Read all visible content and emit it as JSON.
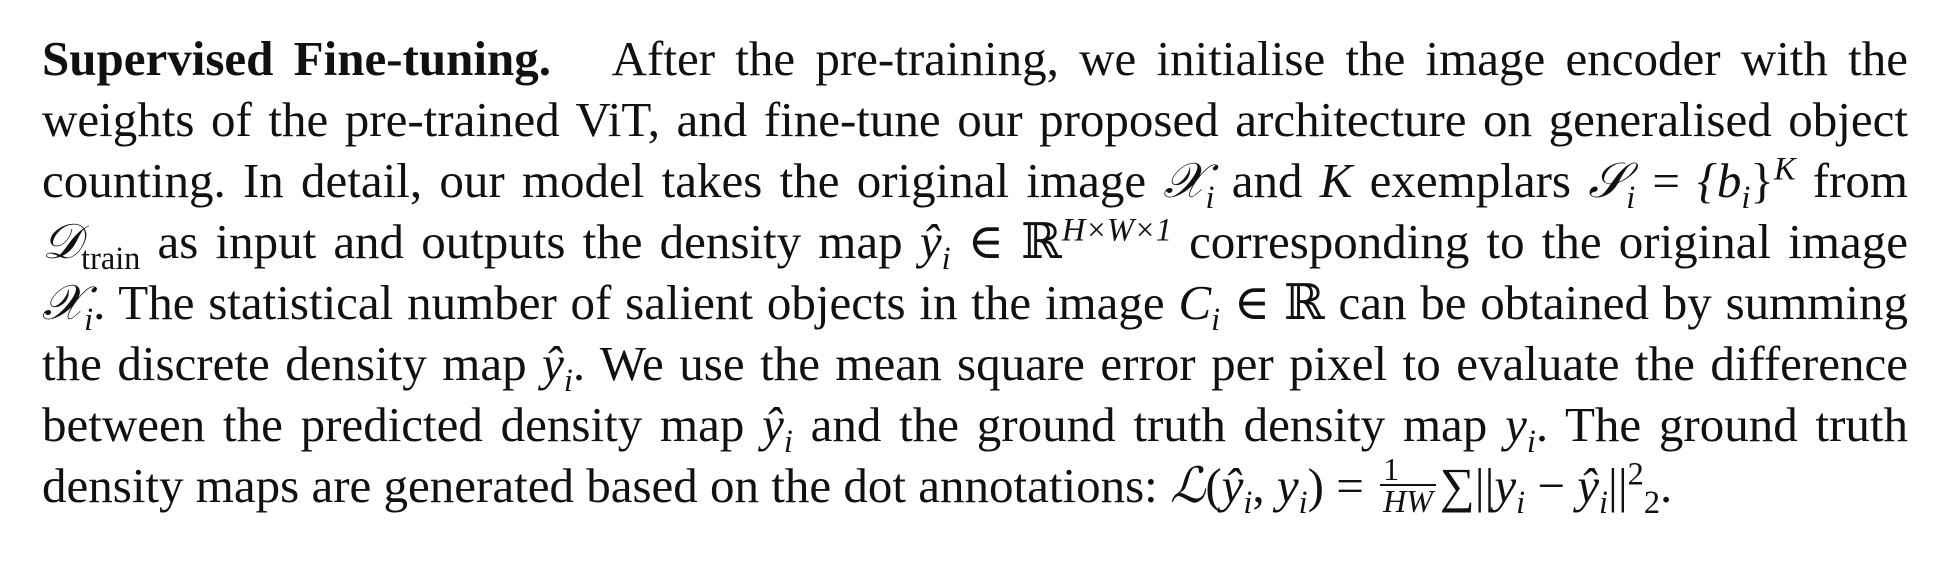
{
  "heading": "Supervised Fine-tuning.",
  "lines": [
    "After the pre-training, we initialise the image encoder with the",
    "weights of the pre-trained ViT, and fine-tune our proposed architecture on generalised object",
    "counting. In detail, our model takes the original image",
    "and",
    "exemplars",
    "from",
    "as input and outputs the density map",
    "corresponding to the original image",
    ". The statistical number of salient objects in the image",
    "can be obtained by summing",
    "the discrete density map",
    ". We use the mean square error per pixel to evaluate the difference",
    "between the predicted density map",
    "and the ground truth density map",
    ". The ground truth",
    "density maps are generated based on the dot annotations:"
  ],
  "math": {
    "X": "𝒳",
    "i": "i",
    "K": "K",
    "S": "𝒮",
    "eq": "=",
    "set": "{b",
    "setclose": "}",
    "D": "𝒟",
    "train": "train",
    "yhat": "ŷ",
    "in": "∈",
    "R": "ℝ",
    "dims": "H×W×1",
    "C": "C",
    "y": "y",
    "L": "ℒ",
    "frac_num": "1",
    "frac_den": "HW",
    "sum": "∑",
    "norm": "||",
    "minus": "−",
    "two": "2"
  }
}
